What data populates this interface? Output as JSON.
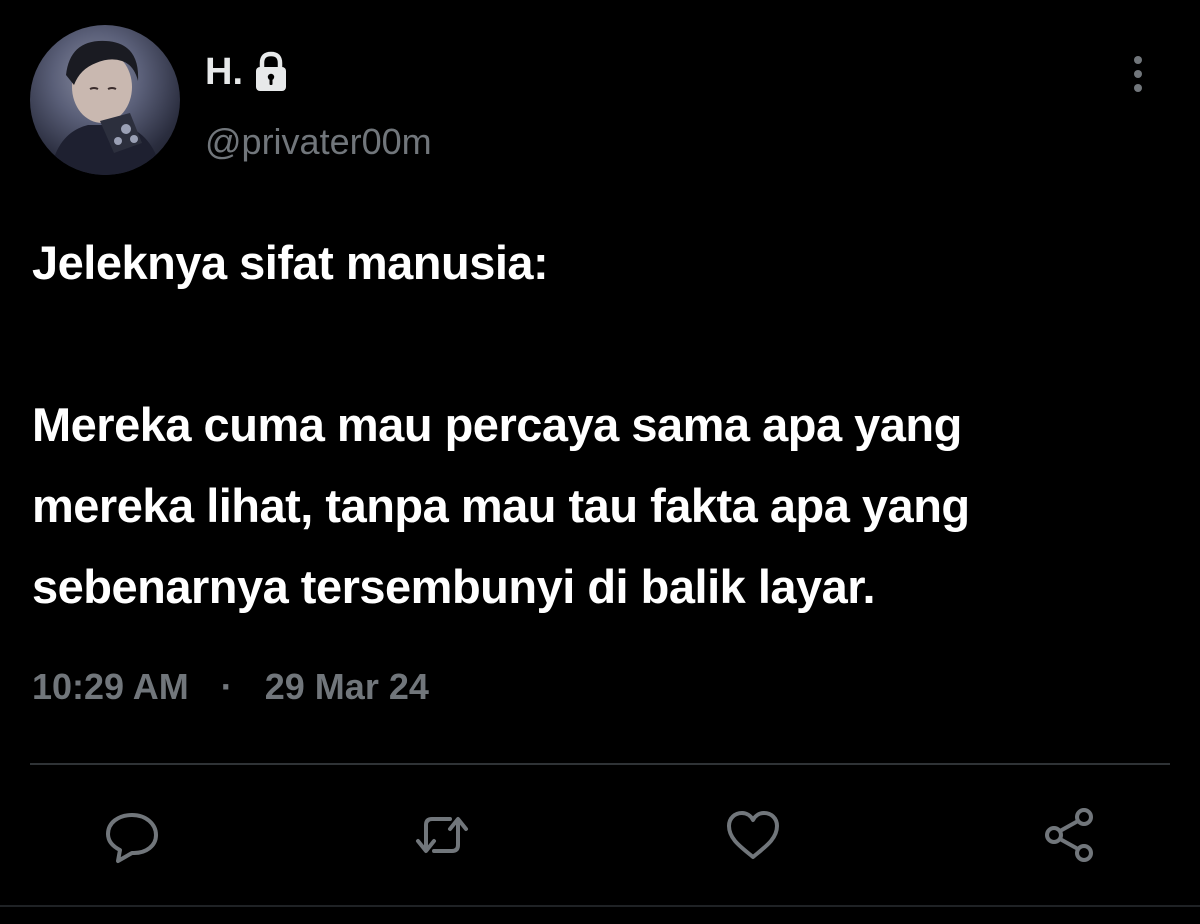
{
  "user": {
    "display_name": "H.",
    "handle": "@privater00m",
    "protected_icon": "lock-icon",
    "avatar_icon": "profile-photo"
  },
  "tweet": {
    "text": "Jeleknya sifat manusia:\n\nMereka cuma mau percaya sama apa yang\nmereka lihat, tanpa mau tau fakta apa yang\nsebenarnya tersembunyi di balik layar.",
    "time": "10:29 AM",
    "separator": "·",
    "date": "29 Mar 24"
  },
  "actions": {
    "more": "more-options-icon",
    "reply": "reply-icon",
    "retweet": "retweet-icon",
    "like": "like-icon",
    "share": "share-icon"
  },
  "colors": {
    "background": "#000000",
    "primary_text": "#e7e9ea",
    "secondary_text": "#71767b",
    "divider": "#2f3336"
  }
}
